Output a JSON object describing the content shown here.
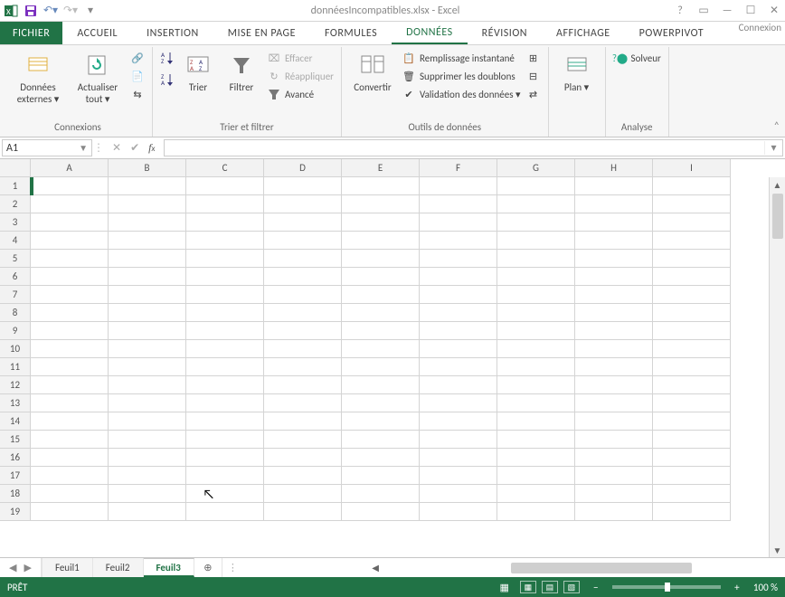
{
  "titlebar": {
    "title": "donnéesIncompatibles.xlsx - Excel",
    "signin": "Connexion"
  },
  "tabs": {
    "file": "FICHIER",
    "items": [
      "ACCUEIL",
      "INSERTION",
      "MISE EN PAGE",
      "FORMULES",
      "DONNÉES",
      "RÉVISION",
      "AFFICHAGE",
      "POWERPIVOT"
    ],
    "active_index": 4
  },
  "ribbon": {
    "connexions": {
      "label": "Connexions",
      "ext_data": "Données externes ▾",
      "refresh": "Actualiser tout ▾"
    },
    "sortfilter": {
      "label": "Trier et filtrer",
      "sort": "Trier",
      "filter": "Filtrer",
      "clear": "Effacer",
      "reapply": "Réappliquer",
      "advanced": "Avancé"
    },
    "datatools": {
      "label": "Outils de données",
      "convert": "Convertir",
      "flashfill": "Remplissage instantané",
      "removedup": "Supprimer les doublons",
      "validation": "Validation des données ▾"
    },
    "outline": {
      "label": "",
      "plan": "Plan ▾"
    },
    "analysis": {
      "label": "Analyse",
      "solver": "Solveur"
    }
  },
  "formulabar": {
    "namebox": "A1",
    "value": ""
  },
  "grid": {
    "cols": [
      "A",
      "B",
      "C",
      "D",
      "E",
      "F",
      "G",
      "H",
      "I"
    ],
    "rows": [
      "1",
      "2",
      "3",
      "4",
      "5",
      "6",
      "7",
      "8",
      "9",
      "10",
      "11",
      "12",
      "13",
      "14",
      "15",
      "16",
      "17",
      "18",
      "19"
    ]
  },
  "sheettabs": {
    "tabs": [
      "Feuil1",
      "Feuil2",
      "Feuil3"
    ],
    "active_index": 2
  },
  "statusbar": {
    "ready": "PRÊT",
    "zoom": "100 %"
  }
}
